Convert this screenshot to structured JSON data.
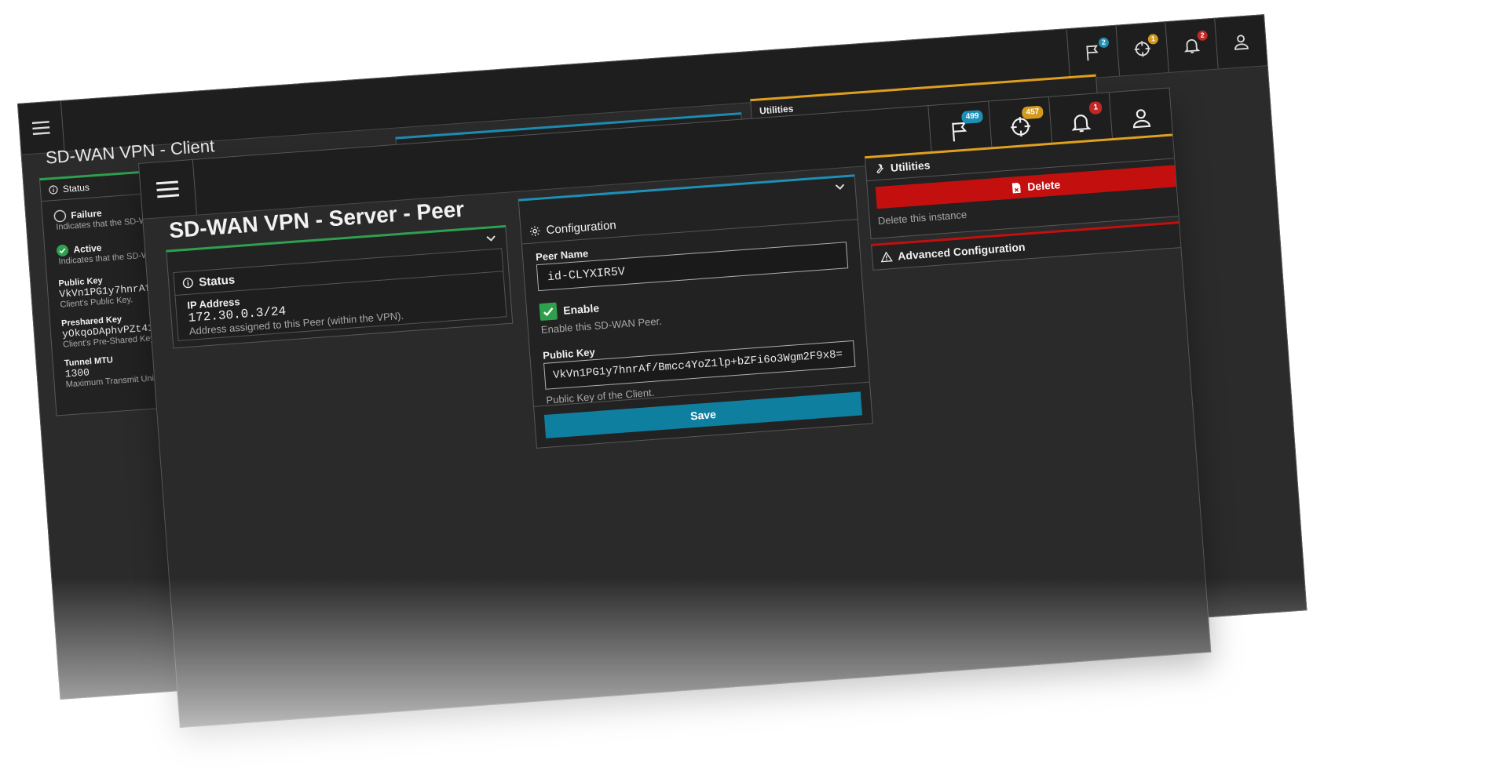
{
  "back_window": {
    "title": "SD-WAN VPN - Client",
    "notifications": [
      {
        "icon": "flag-icon",
        "count": "2",
        "color": "#1e8fb5"
      },
      {
        "icon": "crosshair-icon",
        "count": "1",
        "color": "#d39a1e"
      },
      {
        "icon": "bell-icon",
        "count": "2",
        "color": "#c02828"
      },
      {
        "icon": "user-icon",
        "count": "",
        "color": ""
      }
    ],
    "status_panel": {
      "heading": "Status",
      "items": [
        {
          "label": "Failure",
          "description": "Indicates that the SD-WAN",
          "state": "off"
        },
        {
          "label": "Active",
          "description": "Indicates that the SD-WAN",
          "state": "on"
        }
      ],
      "fields": [
        {
          "label": "Public Key",
          "value": "VkVn1PG1y7hnrAf/",
          "hint": "Client's Public Key."
        },
        {
          "label": "Preshared Key",
          "value": "yOkqoDAphvPZt410",
          "hint": "Client's Pre-Shared Key."
        },
        {
          "label": "Tunnel MTU",
          "value": "1300",
          "hint": "Maximum Transmit Unit ("
        }
      ]
    },
    "config_heading": "Configuration",
    "utilities_heading": "Utilities"
  },
  "front_window": {
    "title": "SD-WAN VPN - Server - Peer",
    "notifications": [
      {
        "icon": "flag-icon",
        "count": "499",
        "color": "#1e8fb5"
      },
      {
        "icon": "crosshair-icon",
        "count": "457",
        "color": "#d39a1e"
      },
      {
        "icon": "bell-icon",
        "count": "1",
        "color": "#c02828"
      },
      {
        "icon": "user-icon",
        "count": "",
        "color": ""
      }
    ],
    "status_panel": {
      "heading": "Status",
      "ip_label": "IP Address",
      "ip_value": "172.30.0.3/24",
      "ip_hint": "Address assigned to this Peer (within the VPN)."
    },
    "config_panel": {
      "heading": "Configuration",
      "peer_name_label": "Peer Name",
      "peer_name_value": "id-CLYXIR5V",
      "enable_label": "Enable",
      "enable_hint": "Enable this SD-WAN Peer.",
      "enabled": true,
      "public_key_label": "Public Key",
      "public_key_value": "VkVn1PG1y7hnrAf/Bmcc4YoZ1lp+bZFi6o3Wgm2F9x8=",
      "public_key_hint": "Public Key of the Client.",
      "save_label": "Save"
    },
    "utilities_panel": {
      "heading": "Utilities",
      "delete_label": "Delete",
      "delete_hint": "Delete this instance"
    },
    "advanced_panel": {
      "heading": "Advanced Configuration"
    }
  },
  "colors": {
    "status_accent": "#2ea04f",
    "config_accent": "#1e8fb5",
    "utilities_accent": "#e0a020",
    "danger": "#c40f0f",
    "save_button": "#0f7fa0"
  }
}
